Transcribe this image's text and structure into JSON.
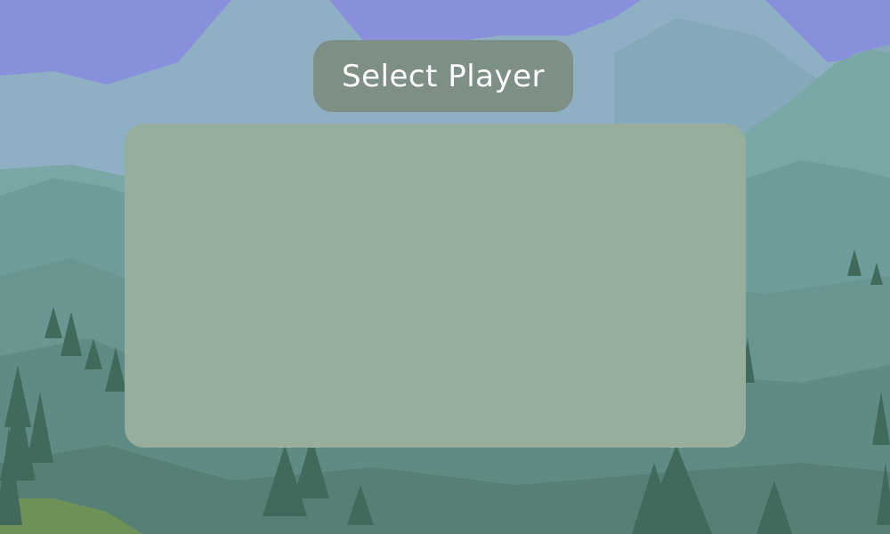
{
  "menu": {
    "title": "Select Player"
  },
  "player_list": {
    "players": []
  },
  "colors": {
    "sky": "#8890dc",
    "title_pill": "#7e8f86",
    "panel": "#98ae9c",
    "title_text": "#ffffff"
  },
  "icons": {
    "background": "mountain-forest-backdrop"
  }
}
